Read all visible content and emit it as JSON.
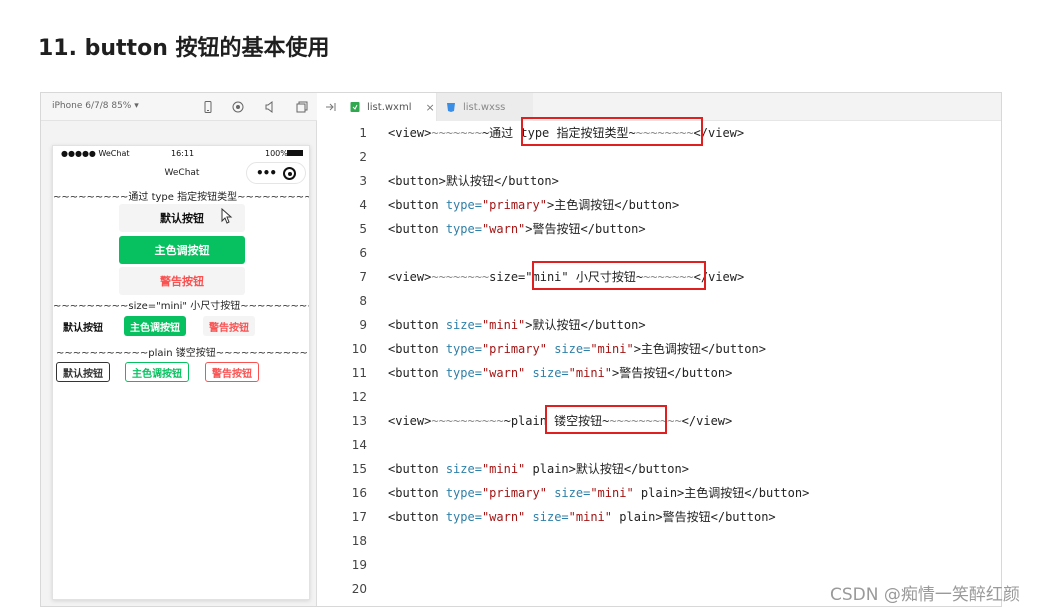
{
  "slide": {
    "title": "11. button 按钮的基本使用"
  },
  "simulator": {
    "device": "iPhone 6/7/8 85% ▾",
    "status": {
      "carrier": "●●●●● WeChat",
      "time": "16:11",
      "battery": "100%"
    },
    "nav_title": "WeChat",
    "capsule_more": "•••",
    "lines": {
      "header1": "~~~~~~~~~通过 type 指定按钮类型~~~~~~~~~",
      "header2": "~~~~~~~~~size=\"mini\" 小尺寸按钮~~~~~~~~~",
      "header3": "~~~~~~~~~~~plain 镂空按钮~~~~~~~~~~~"
    },
    "buttons": {
      "default": "默认按钮",
      "primary": "主色调按钮",
      "warn": "警告按钮"
    }
  },
  "editor": {
    "tabs": [
      {
        "label": "list.wxml",
        "active": true
      },
      {
        "label": "list.wxss",
        "active": false
      }
    ],
    "close_glyph": "×",
    "line_numbers": [
      "1",
      "2",
      "3",
      "4",
      "5",
      "6",
      "7",
      "8",
      "9",
      "10",
      "11",
      "12",
      "13",
      "14",
      "15",
      "16",
      "17",
      "18",
      "19",
      "20"
    ],
    "code": {
      "view_open": "<view>",
      "view_close": "</view>",
      "tilde_a": "~~~~~~~",
      "tilde_b": "~~~~~~~~",
      "tilde_c": "~~~~~~~~",
      "tilde_d": "~~~~~~~",
      "tilde_e": "~~~~~~~~~~",
      "tilde_f": "~~~~~~~~~~",
      "comment1": "~通过 type 指定按钮类型~",
      "comment2": "size=\"mini\" 小尺寸按钮~",
      "comment3": "~plain 镂空按钮~",
      "button_open": "<button",
      "button_close": "</button>",
      "gt": ">",
      "attr_type": "type=",
      "attr_size": "size=",
      "val_primary": "\"primary\"",
      "val_warn": "\"warn\"",
      "val_mini": "\"mini\"",
      "plain": "plain",
      "text_default": "默认按钮",
      "text_primary": "主色调按钮",
      "text_warn": "警告按钮"
    }
  },
  "watermark": "CSDN @痴情一笑醉红颜",
  "colors": {
    "primary": "#07c160",
    "warn": "#fa5151",
    "highlight": "#e02020"
  }
}
